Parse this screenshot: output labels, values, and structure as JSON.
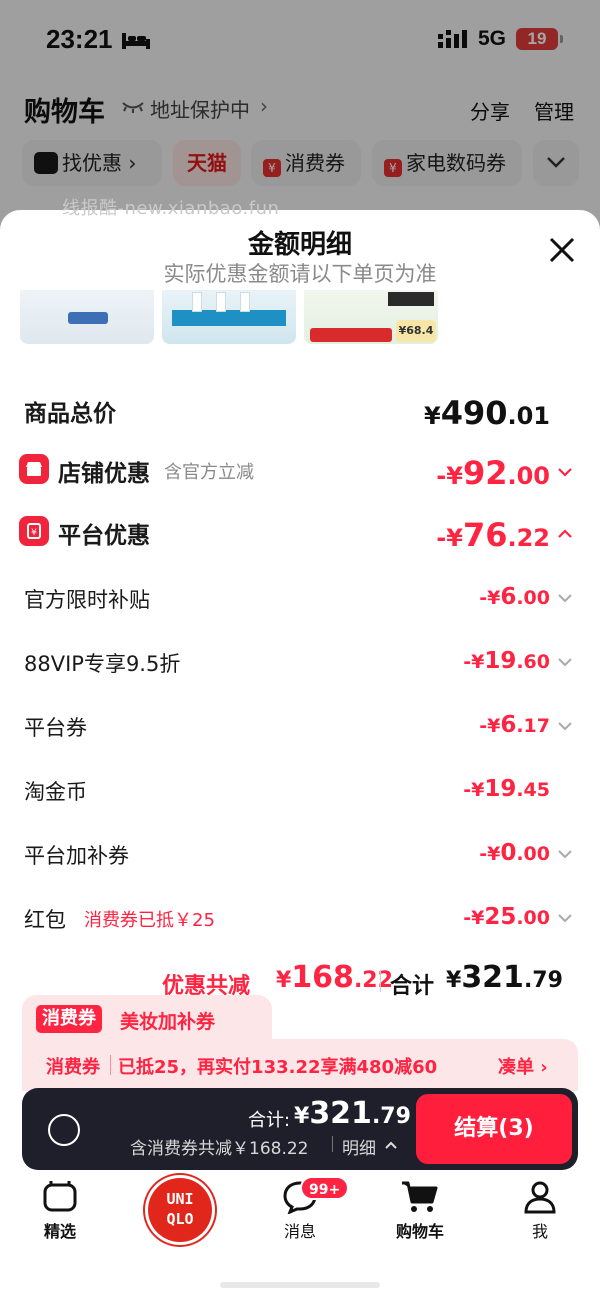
{
  "status_bar": {
    "time": "23:21",
    "network": "5G",
    "battery": "19"
  },
  "header": {
    "title": "购物车",
    "address": "地址保护中",
    "address_chevron": "›",
    "share": "分享",
    "manage": "管理"
  },
  "chips": [
    {
      "label": "找优惠 ›",
      "icon": "tmall-cat-icon"
    },
    {
      "label": "天猫"
    },
    {
      "label": "消费券",
      "icon": "coupon-icon"
    },
    {
      "label": "家电数码券",
      "icon": "coupon-icon"
    }
  ],
  "watermark": "线报酷-new.xianbao.fun",
  "sheet": {
    "title": "金额明细",
    "subtitle": "实际优惠金额请以下单页为准"
  },
  "thumb_price": "¥68.4",
  "rows": {
    "goods_total": {
      "label": "商品总价",
      "currency": "¥",
      "int": "490",
      "dec": ".01"
    },
    "store": {
      "label": "店铺优惠",
      "note": "含官方立减",
      "prefix": "-¥",
      "int": "92",
      "dec": ".00"
    },
    "platform": {
      "label": "平台优惠",
      "prefix": "-¥",
      "int": "76",
      "dec": ".22"
    },
    "subsidy": {
      "label": "官方限时补贴",
      "prefix": "-¥",
      "int": "6",
      "dec": ".00"
    },
    "vip": {
      "label": "88VIP专享9.5折",
      "prefix": "-¥",
      "int": "19",
      "dec": ".60"
    },
    "platform_coupon": {
      "label": "平台券",
      "prefix": "-¥",
      "int": "6",
      "dec": ".17"
    },
    "gold_coin": {
      "label": "淘金币",
      "prefix": "-¥",
      "int": "19",
      "dec": ".45"
    },
    "extra_coupon": {
      "label": "平台加补券",
      "prefix": "-¥",
      "int": "0",
      "dec": ".00"
    },
    "red_packet": {
      "label": "红包",
      "note": "消费券已抵￥25",
      "prefix": "-¥",
      "int": "25",
      "dec": ".00"
    }
  },
  "summary": {
    "discount_label": "优惠共减",
    "discount_prefix": "¥",
    "discount_int": "168",
    "discount_dec": ".22",
    "total_label": "合计",
    "total_prefix": "¥",
    "total_int": "321",
    "total_dec": ".79"
  },
  "coupon": {
    "tag": "消费券",
    "name": "美妆加补券",
    "line_tag": "消费券",
    "line_text": "已抵25，再实付133.22享满480减60",
    "action": "凑单 ›"
  },
  "checkout": {
    "total_label": "合计:",
    "currency": "¥",
    "int": "321",
    "dec": ".79",
    "sub": "含消费券共减￥168.22",
    "detail": "明细",
    "button": "结算(3)"
  },
  "tabs": [
    {
      "label": "精选"
    },
    {
      "label": "UNIQLO",
      "line1": "UNI",
      "line2": "QLO"
    },
    {
      "label": "消息",
      "badge": "99+"
    },
    {
      "label": "购物车"
    },
    {
      "label": "我"
    }
  ],
  "colors": {
    "accent": "#ff2442",
    "checkout_bar": "#1f1f2b",
    "coupon_bg": "#fde6e8"
  }
}
